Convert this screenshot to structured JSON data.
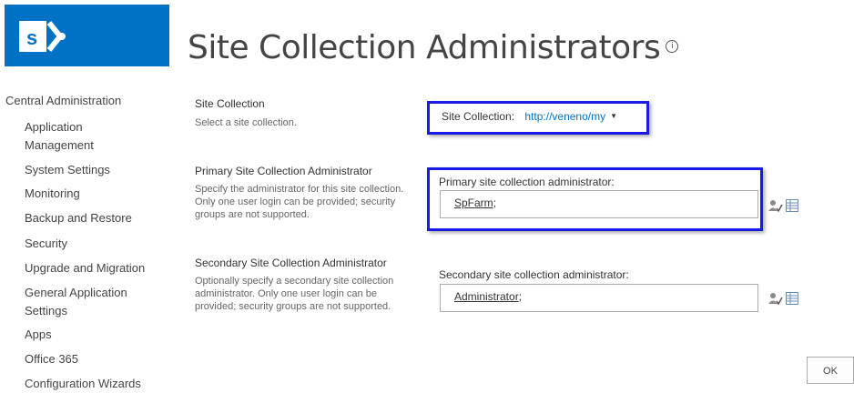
{
  "header": {
    "title": "Site Collection Administrators",
    "info_icon_glyph": "i"
  },
  "nav": {
    "root": "Central Administration",
    "items": [
      "Application Management",
      "System Settings",
      "Monitoring",
      "Backup and Restore",
      "Security",
      "Upgrade and Migration",
      "General Application Settings",
      "Apps",
      "Office 365",
      "Configuration Wizards"
    ]
  },
  "sections": {
    "site_collection": {
      "title": "Site Collection",
      "desc": "Select a site collection.",
      "label": "Site Collection:",
      "value": "http://veneno/my"
    },
    "primary": {
      "title": "Primary Site Collection Administrator",
      "desc": "Specify the administrator for this site collection. Only one user login can be provided; security groups are not supported.",
      "label": "Primary site collection administrator:",
      "value": "SpFarm",
      "suffix": ";"
    },
    "secondary": {
      "title": "Secondary Site Collection Administrator",
      "desc": "Optionally specify a secondary site collection administrator. Only one user login can be provided; security groups are not supported.",
      "label": "Secondary site collection administrator:",
      "value": "Administrator",
      "suffix": ";"
    }
  },
  "buttons": {
    "ok": "OK"
  },
  "colors": {
    "brand": "#0072c6",
    "highlight_box": "#1a1ae6"
  },
  "icons": [
    "sharepoint-logo-icon",
    "info-icon",
    "check-names-icon",
    "browse-address-book-icon"
  ]
}
